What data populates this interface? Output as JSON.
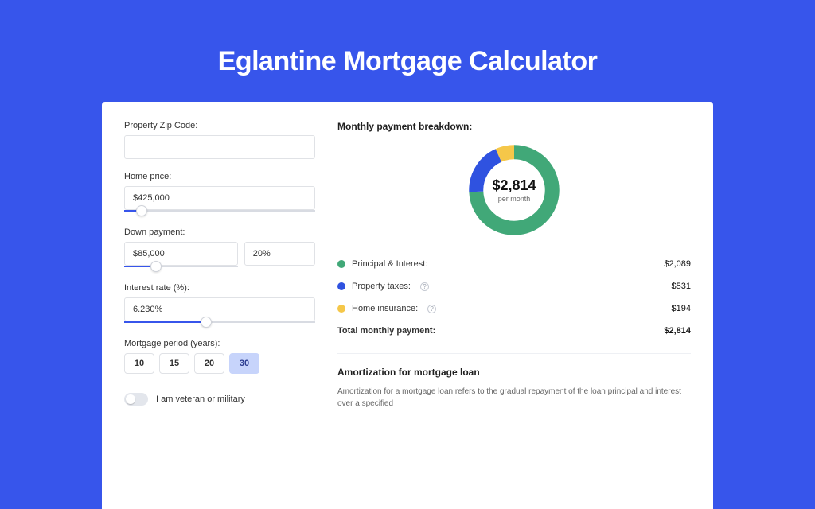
{
  "page": {
    "title": "Eglantine Mortgage Calculator"
  },
  "form": {
    "zip": {
      "label": "Property Zip Code:",
      "value": ""
    },
    "home_price": {
      "label": "Home price:",
      "value": "$425,000",
      "slider_pct": 9
    },
    "down_payment": {
      "label": "Down payment:",
      "amount": "$85,000",
      "percent": "20%",
      "slider_pct": 28
    },
    "interest_rate": {
      "label": "Interest rate (%):",
      "value": "6.230%",
      "slider_pct": 43
    },
    "mortgage_period": {
      "label": "Mortgage period (years):",
      "options": [
        "10",
        "15",
        "20",
        "30"
      ],
      "selected": "30"
    },
    "veteran": {
      "label": "I am veteran or military",
      "checked": false
    }
  },
  "breakdown": {
    "title": "Monthly payment breakdown:",
    "total_display": "$2,814",
    "per_label": "per month",
    "items": [
      {
        "key": "principal_interest",
        "label": "Principal & Interest:",
        "value": "$2,089",
        "pct": 74.2,
        "color": "#41a878"
      },
      {
        "key": "property_taxes",
        "label": "Property taxes:",
        "value": "$531",
        "pct": 18.9,
        "color": "#2f52e0",
        "info": true
      },
      {
        "key": "home_insurance",
        "label": "Home insurance:",
        "value": "$194",
        "pct": 6.9,
        "color": "#f5c749",
        "info": true
      }
    ],
    "total_row": {
      "label": "Total monthly payment:",
      "value": "$2,814"
    }
  },
  "amortization": {
    "title": "Amortization for mortgage loan",
    "body": "Amortization for a mortgage loan refers to the gradual repayment of the loan principal and interest over a specified"
  },
  "chart_data": {
    "type": "pie",
    "title": "Monthly payment breakdown",
    "categories": [
      "Principal & Interest",
      "Property taxes",
      "Home insurance"
    ],
    "values": [
      2089,
      531,
      194
    ],
    "series_colors": [
      "#41a878",
      "#2f52e0",
      "#f5c749"
    ],
    "total": 2814,
    "center_label": "$2,814 per month"
  }
}
